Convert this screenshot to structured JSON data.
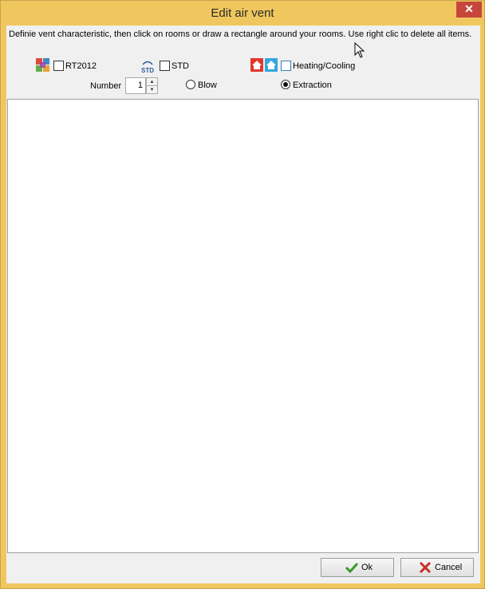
{
  "window": {
    "title": "Edit air vent",
    "close_label": "✕"
  },
  "hint": "Definie vent characteristic, then click on rooms or draw a rectangle around your rooms. Use right clic to delete all items.",
  "options": {
    "rt2012": {
      "label": "RT2012",
      "checked": false,
      "icon": "rt2012-logo-icon"
    },
    "std": {
      "label": "STD",
      "checked": false,
      "icon": "std-icon",
      "icon_text": "STD"
    },
    "heating": {
      "label": "Heating/Cooling",
      "checked": false,
      "icon": "house-heating-cooling-icon"
    }
  },
  "number": {
    "label": "Number",
    "value": "1"
  },
  "flow": {
    "blow": {
      "label": "Blow",
      "selected": false
    },
    "extraction": {
      "label": "Extraction",
      "selected": true
    }
  },
  "buttons": {
    "ok": {
      "label": "Ok",
      "icon": "checkmark-icon",
      "color": "#3a9a2c"
    },
    "cancel": {
      "label": "Cancel",
      "icon": "red-x-icon",
      "color": "#c8302a"
    }
  },
  "colors": {
    "title_bar": "#f0c75e",
    "close": "#c7463c",
    "client": "#f0f0f0"
  }
}
